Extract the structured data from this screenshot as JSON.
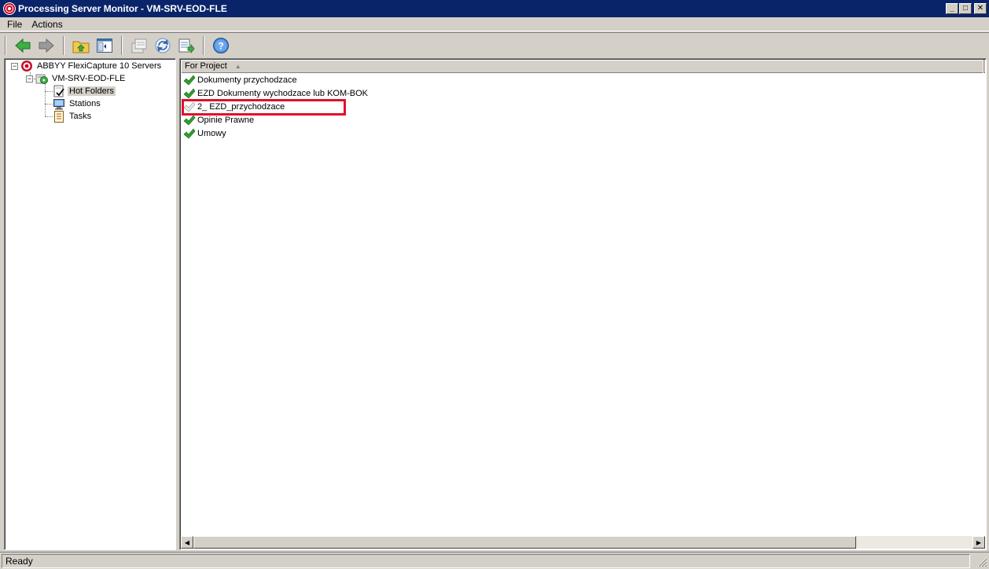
{
  "window": {
    "title": "Processing Server Monitor - VM-SRV-EOD-FLE",
    "minimize": "_",
    "maximize": "□",
    "close": "✕"
  },
  "menu": {
    "items": [
      "File",
      "Actions"
    ]
  },
  "toolbar": {
    "buttons": [
      "back-icon",
      "forward-icon",
      "up-folder-icon",
      "show-hide-tree-icon",
      "export-icon",
      "refresh-icon",
      "export-list-icon",
      "help-icon"
    ]
  },
  "tree": {
    "root": "ABBYY FlexiCapture 10 Servers",
    "server": "VM-SRV-EOD-FLE",
    "children": [
      "Hot Folders",
      "Stations",
      "Tasks"
    ],
    "expander_open": "−"
  },
  "list": {
    "column_header": "For Project",
    "sort_arrow": "▲",
    "rows": [
      {
        "label": "Dokumenty przychodzace",
        "status": "ok"
      },
      {
        "label": "EZD Dokumenty wychodzace lub KOM-BOK",
        "status": "ok"
      },
      {
        "label": "2_ EZD_przychodzace",
        "status": "disabled"
      },
      {
        "label": "Opinie Prawne",
        "status": "ok"
      },
      {
        "label": "Umowy",
        "status": "ok"
      }
    ],
    "highlight_color": "#e0102a"
  },
  "scrollbar": {
    "left_arrow": "◀",
    "right_arrow": "▶"
  },
  "status": {
    "text": "Ready"
  },
  "colors": {
    "titlebar": "#0a246a",
    "chrome": "#d4d0c8",
    "check_green": "#2e9e2e"
  }
}
